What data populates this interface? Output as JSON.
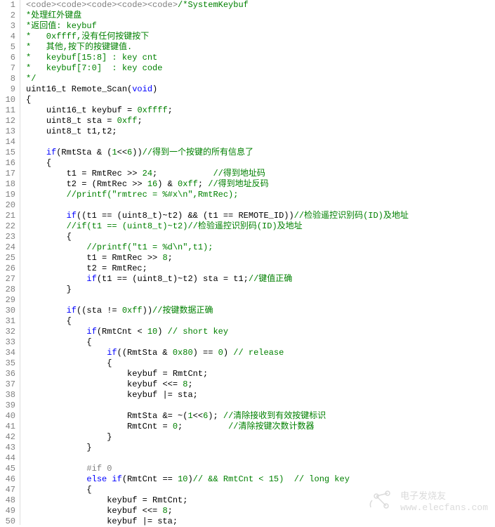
{
  "watermark": {
    "title": "电子发烧友",
    "url": "www.elecfans.com"
  },
  "lines": [
    {
      "n": 1,
      "html": "<span class='preproc'>&lt;code&gt;&lt;code&gt;&lt;code&gt;&lt;code&gt;&lt;code&gt;</span><span class='comment'>/*SystemKeybuf</span>"
    },
    {
      "n": 2,
      "html": "<span class='comment'>*处理红外键盘</span>"
    },
    {
      "n": 3,
      "html": "<span class='comment'>*返回值: keybuf</span>"
    },
    {
      "n": 4,
      "html": "<span class='comment'>*   0xffff,没有任何按键按下</span>"
    },
    {
      "n": 5,
      "html": "<span class='comment'>*   其他,按下的按键键值.</span>"
    },
    {
      "n": 6,
      "html": "<span class='comment'>*   keybuf[15:8] : key cnt</span>"
    },
    {
      "n": 7,
      "html": "<span class='comment'>*   keybuf[7:0]  : key code</span>"
    },
    {
      "n": 8,
      "html": "<span class='comment'>*/</span>"
    },
    {
      "n": 9,
      "html": "<span class='ident'>uint16_t Remote_Scan(</span><span class='keyword'>void</span><span class='ident'>)</span>"
    },
    {
      "n": 10,
      "html": "<span class='punct'>{</span>"
    },
    {
      "n": 11,
      "html": "    <span class='ident'>uint16_t keybuf = </span><span class='number'>0xffff</span><span class='punct'>;</span>"
    },
    {
      "n": 12,
      "html": "    <span class='ident'>uint8_t sta = </span><span class='number'>0xff</span><span class='punct'>;</span>"
    },
    {
      "n": 13,
      "html": "    <span class='ident'>uint8_t t1,t2;</span>"
    },
    {
      "n": 14,
      "html": ""
    },
    {
      "n": 15,
      "html": "    <span class='keyword'>if</span><span class='ident'>(RmtSta &amp; (</span><span class='number'>1</span><span class='ident'>&lt;&lt;</span><span class='number'>6</span><span class='ident'>))</span><span class='comment'>//得到一个按键的所有信息了</span>"
    },
    {
      "n": 16,
      "html": "    <span class='punct'>{</span>"
    },
    {
      "n": 17,
      "html": "        <span class='ident'>t1 = RmtRec &gt;&gt; </span><span class='number'>24</span><span class='punct'>;</span>           <span class='comment'>//得到地址码</span>"
    },
    {
      "n": 18,
      "html": "        <span class='ident'>t2 = (RmtRec &gt;&gt; </span><span class='number'>16</span><span class='ident'>) &amp; </span><span class='number'>0xff</span><span class='punct'>;</span> <span class='comment'>//得到地址反码</span>"
    },
    {
      "n": 19,
      "html": "        <span class='comment'>//printf(\"rmtrec = %#x\\n\",RmtRec);</span>"
    },
    {
      "n": 20,
      "html": ""
    },
    {
      "n": 21,
      "html": "        <span class='keyword'>if</span><span class='ident'>((t1 == (uint8_t)~t2) &amp;&amp; (t1 == REMOTE_ID))</span><span class='comment'>//检验遥控识别码(ID)及地址</span>"
    },
    {
      "n": 22,
      "html": "        <span class='comment'>//if(t1 == (uint8_t)~t2)//检验遥控识别码(ID)及地址</span>"
    },
    {
      "n": 23,
      "html": "        <span class='punct'>{</span>"
    },
    {
      "n": 24,
      "html": "            <span class='comment'>//printf(\"t1 = %d\\n\",t1);</span>"
    },
    {
      "n": 25,
      "html": "            <span class='ident'>t1 = RmtRec &gt;&gt; </span><span class='number'>8</span><span class='punct'>;</span>"
    },
    {
      "n": 26,
      "html": "            <span class='ident'>t2 = RmtRec;</span>"
    },
    {
      "n": 27,
      "html": "            <span class='keyword'>if</span><span class='ident'>(t1 == (uint8_t)~t2) sta = t1;</span><span class='comment'>//键值正确</span>"
    },
    {
      "n": 28,
      "html": "        <span class='punct'>}</span>"
    },
    {
      "n": 29,
      "html": ""
    },
    {
      "n": 30,
      "html": "        <span class='keyword'>if</span><span class='ident'>((sta != </span><span class='number'>0xff</span><span class='ident'>))</span><span class='comment'>//按键数据正确</span>"
    },
    {
      "n": 31,
      "html": "        <span class='punct'>{</span>"
    },
    {
      "n": 32,
      "html": "            <span class='keyword'>if</span><span class='ident'>(RmtCnt &lt; </span><span class='number'>10</span><span class='ident'>)</span> <span class='comment'>// short key</span>"
    },
    {
      "n": 33,
      "html": "            <span class='punct'>{</span>"
    },
    {
      "n": 34,
      "html": "                <span class='keyword'>if</span><span class='ident'>((RmtSta &amp; </span><span class='number'>0x80</span><span class='ident'>) == </span><span class='number'>0</span><span class='ident'>)</span> <span class='comment'>// release</span>"
    },
    {
      "n": 35,
      "html": "                <span class='punct'>{</span>"
    },
    {
      "n": 36,
      "html": "                    <span class='ident'>keybuf = RmtCnt;</span>"
    },
    {
      "n": 37,
      "html": "                    <span class='ident'>keybuf &lt;&lt;= </span><span class='number'>8</span><span class='punct'>;</span>"
    },
    {
      "n": 38,
      "html": "                    <span class='ident'>keybuf |= sta;</span>"
    },
    {
      "n": 39,
      "html": ""
    },
    {
      "n": 40,
      "html": "                    <span class='ident'>RmtSta &amp;= ~(</span><span class='number'>1</span><span class='ident'>&lt;&lt;</span><span class='number'>6</span><span class='ident'>);</span> <span class='comment'>//清除接收到有效按键标识</span>"
    },
    {
      "n": 41,
      "html": "                    <span class='ident'>RmtCnt = </span><span class='number'>0</span><span class='punct'>;</span>         <span class='comment'>//清除按键次数计数器</span>"
    },
    {
      "n": 42,
      "html": "                <span class='punct'>}</span>"
    },
    {
      "n": 43,
      "html": "            <span class='punct'>}</span>"
    },
    {
      "n": 44,
      "html": ""
    },
    {
      "n": 45,
      "html": "            <span class='preproc'>#if 0</span>"
    },
    {
      "n": 46,
      "html": "            <span class='keyword'>else if</span><span class='ident'>(RmtCnt == </span><span class='number'>10</span><span class='ident'>)</span><span class='comment'>// &amp;&amp; RmtCnt &lt; 15)  // long key</span>"
    },
    {
      "n": 47,
      "html": "            <span class='punct'>{</span>"
    },
    {
      "n": 48,
      "html": "                <span class='ident'>keybuf = RmtCnt;</span>"
    },
    {
      "n": 49,
      "html": "                <span class='ident'>keybuf &lt;&lt;= </span><span class='number'>8</span><span class='punct'>;</span>"
    },
    {
      "n": 50,
      "html": "                <span class='ident'>keybuf |= sta;</span>"
    }
  ]
}
